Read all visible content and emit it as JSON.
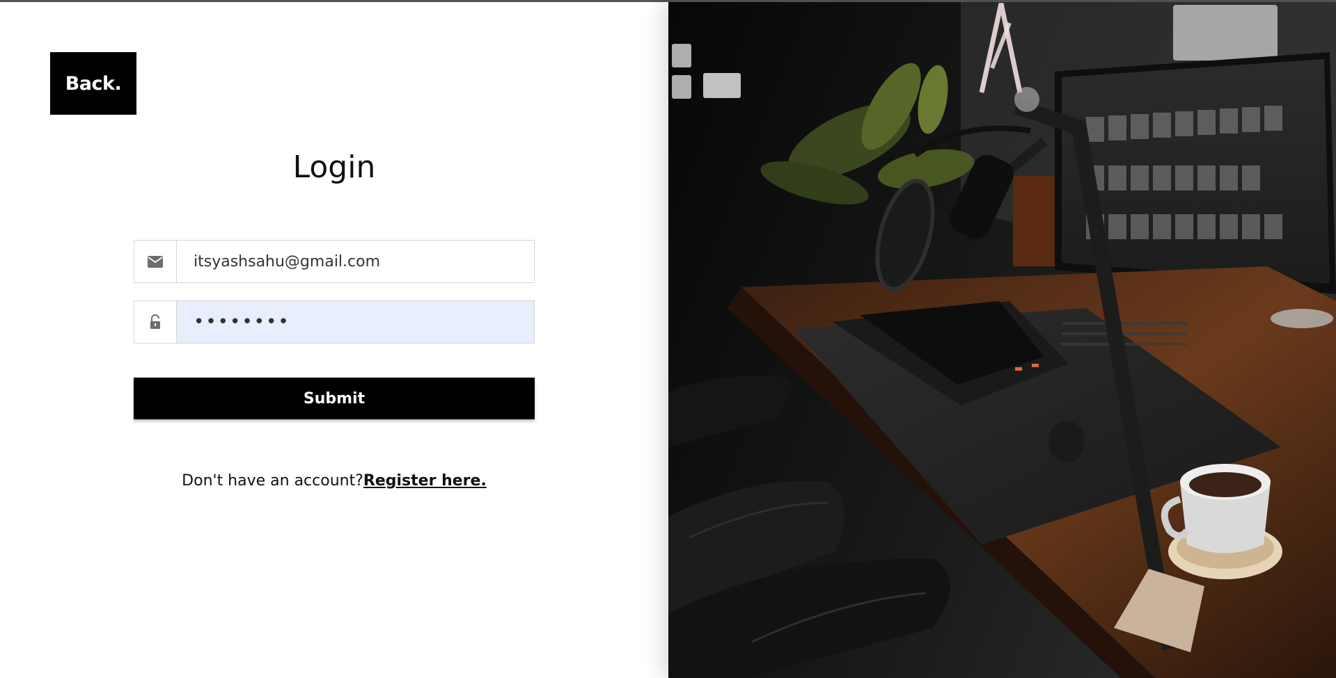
{
  "logo": {
    "label": "Back."
  },
  "form": {
    "title": "Login",
    "email": {
      "value": "itsyashsahu@gmail.com",
      "icon": "envelope-icon"
    },
    "password": {
      "value": "••••••••",
      "icon": "unlock-icon"
    },
    "submit_label": "Submit"
  },
  "register": {
    "prompt": "Don't have an account?",
    "link_label": "Register here."
  },
  "colors": {
    "accent": "#000000",
    "autofill_bg": "#e8effc",
    "border": "#d6d6d6"
  }
}
